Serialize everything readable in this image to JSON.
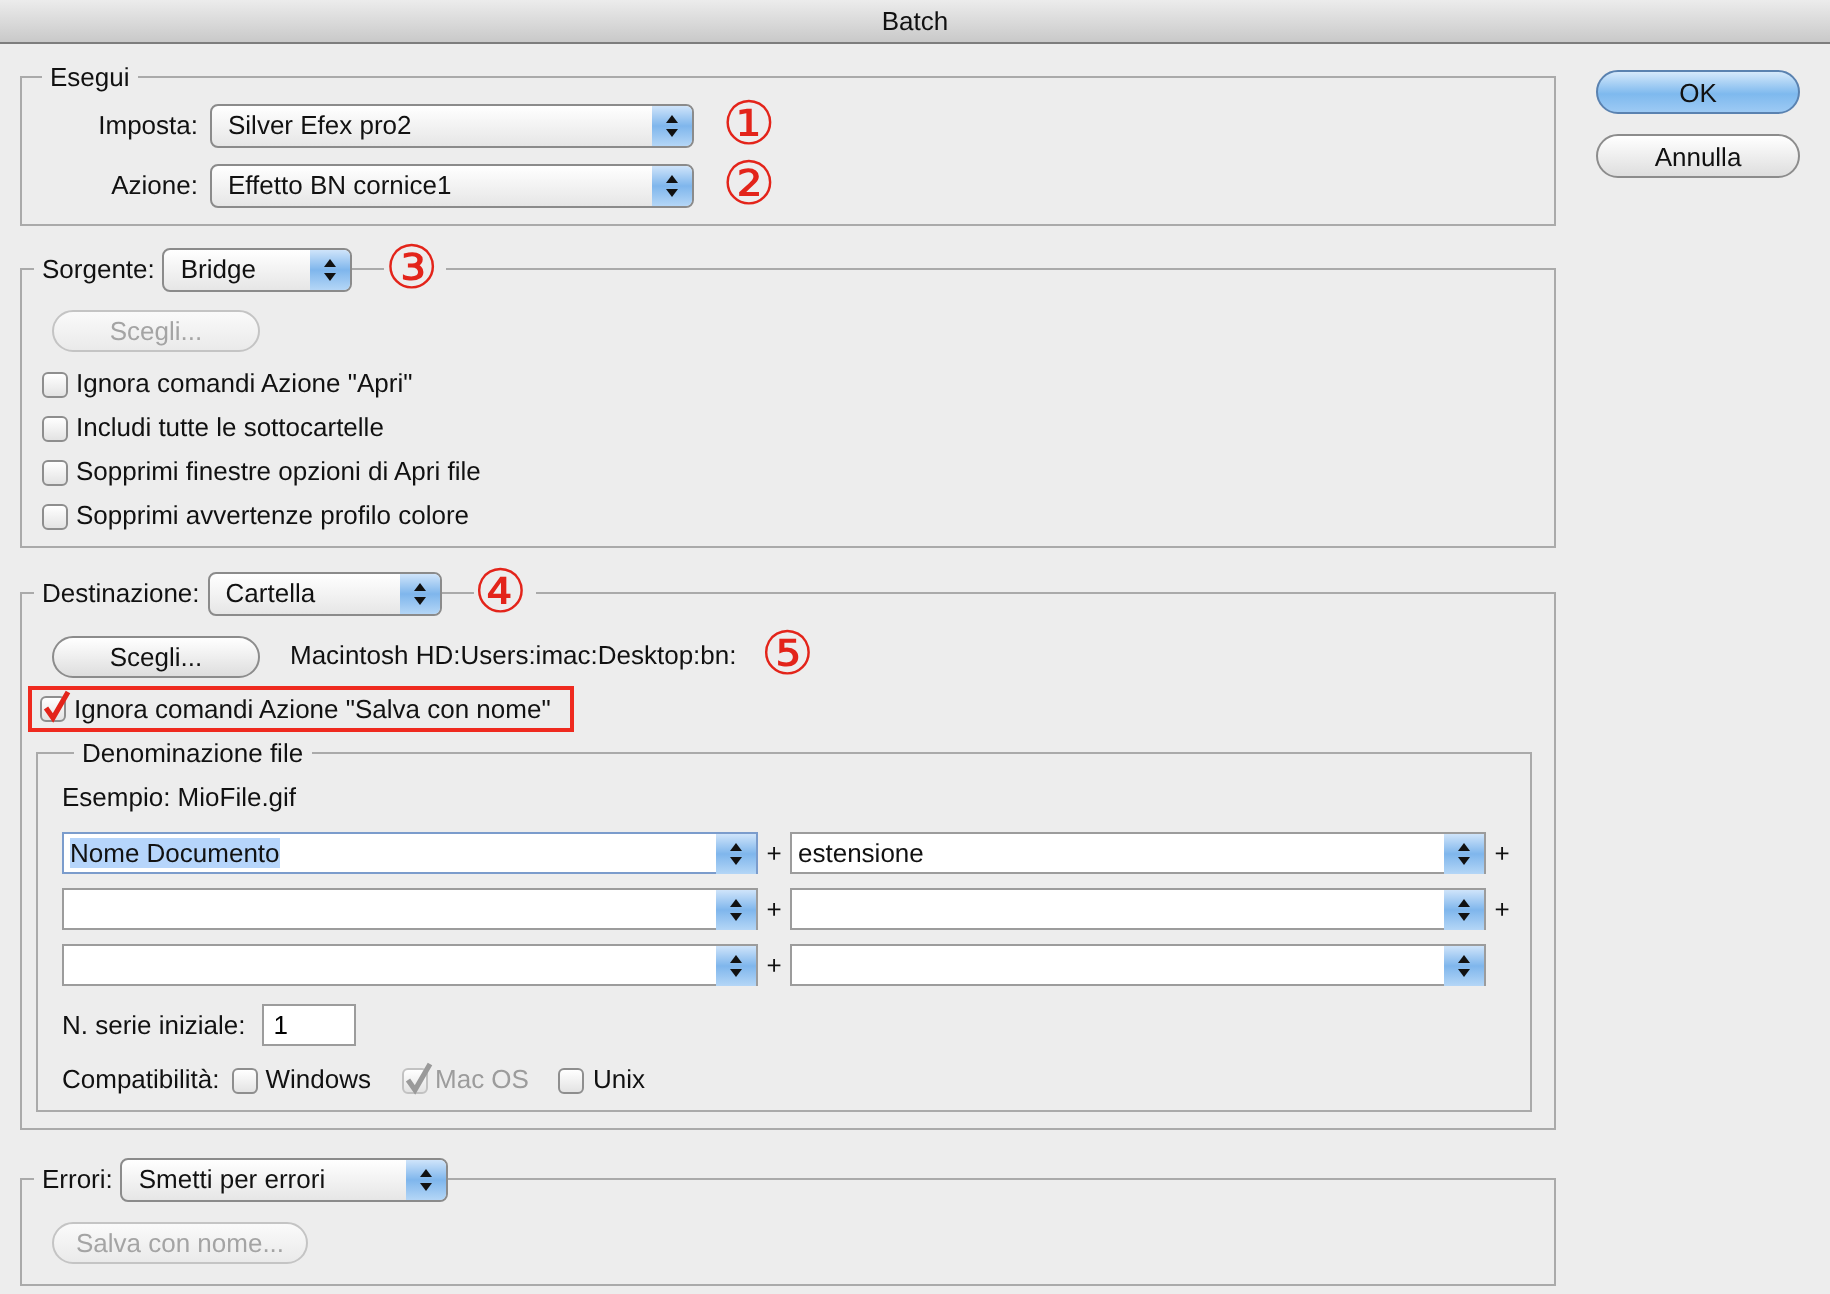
{
  "window": {
    "title": "Batch"
  },
  "esegui": {
    "legend": "Esegui",
    "fields": [
      {
        "label": "Imposta:",
        "value": "Silver Efex pro2",
        "marker": "①"
      },
      {
        "label": "Azione:",
        "value": "Effetto BN cornice1",
        "marker": "②"
      }
    ]
  },
  "sorgente": {
    "label": "Sorgente:",
    "value": "Bridge",
    "marker": "③",
    "choose_button": {
      "label": "Scegli...",
      "disabled": true
    },
    "options": [
      {
        "label": "Ignora comandi Azione \"Apri\"",
        "checked": false
      },
      {
        "label": "Includi tutte le sottocartelle",
        "checked": false
      },
      {
        "label": "Sopprimi finestre opzioni di Apri file",
        "checked": false
      },
      {
        "label": "Sopprimi avvertenze profilo colore",
        "checked": false
      }
    ]
  },
  "destinazione": {
    "label": "Destinazione:",
    "value": "Cartella",
    "marker": "④",
    "choose_button": {
      "label": "Scegli...",
      "disabled": false
    },
    "path": "Macintosh HD:Users:imac:Desktop:bn:",
    "path_marker": "⑤",
    "option": {
      "label": "Ignora comandi Azione \"Salva con nome\"",
      "checked": true,
      "highlighted": true
    },
    "naming": {
      "legend": "Denominazione file",
      "example": "Esempio: MioFile.gif",
      "rows": [
        {
          "left": {
            "value": "Nome Documento",
            "selected": true
          },
          "joiner": "+",
          "right": {
            "value": "estensione",
            "selected": false
          },
          "trailing": "+"
        },
        {
          "left": {
            "selected": false
          },
          "joiner": "+",
          "right": {
            "selected": false
          },
          "trailing": "+"
        },
        {
          "left": {
            "selected": false
          },
          "joiner": "+",
          "right": {
            "selected": false
          }
        }
      ],
      "start_number": {
        "label": "N. serie iniziale:",
        "value": "1"
      },
      "compatibility": {
        "label": "Compatibilità:",
        "options": [
          {
            "label": "Windows",
            "checked": false,
            "disabled": false
          },
          {
            "label": "Mac OS",
            "checked": true,
            "disabled": true
          },
          {
            "label": "Unix",
            "checked": false,
            "disabled": false
          }
        ]
      }
    }
  },
  "errori": {
    "label": "Errori:",
    "value": "Smetti per errori",
    "save_button": {
      "label": "Salva con nome...",
      "disabled": true
    }
  },
  "buttons": [
    {
      "label": "OK",
      "default": true
    },
    {
      "label": "Annulla",
      "default": false
    }
  ]
}
